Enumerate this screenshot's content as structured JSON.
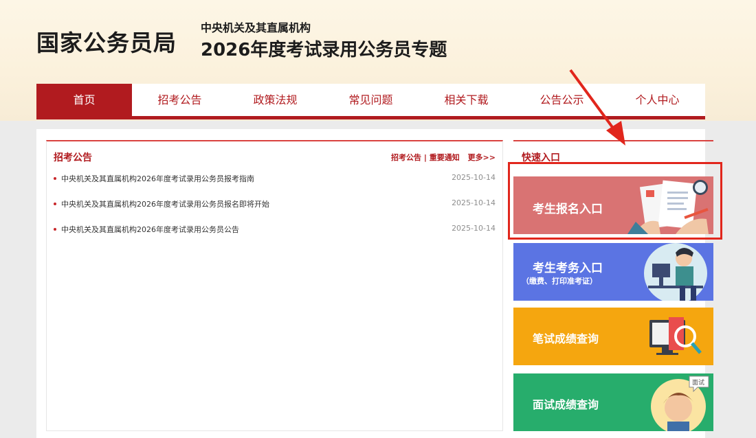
{
  "header": {
    "logo": "国家公务员局",
    "subtitle_line1": "中央机关及其直属机构",
    "subtitle_line2": "2026年度考试录用公务员专题"
  },
  "nav": {
    "items": [
      {
        "label": "首页",
        "active": true
      },
      {
        "label": "招考公告",
        "active": false
      },
      {
        "label": "政策法规",
        "active": false
      },
      {
        "label": "常见问题",
        "active": false
      },
      {
        "label": "相关下载",
        "active": false
      },
      {
        "label": "公告公示",
        "active": false
      },
      {
        "label": "个人中心",
        "active": false
      }
    ]
  },
  "notices": {
    "title": "招考公告",
    "link_announce": "招考公告",
    "separator": "|",
    "link_important": "重要通知",
    "link_more": "更多>>",
    "items": [
      {
        "title": "中央机关及其直属机构2026年度考试录用公务员报考指南",
        "date": "2025-10-14"
      },
      {
        "title": "中央机关及其直属机构2026年度考试录用公务员报名即将开始",
        "date": "2025-10-14"
      },
      {
        "title": "中央机关及其直属机构2026年度考试录用公务员公告",
        "date": "2025-10-14"
      }
    ]
  },
  "quick": {
    "title": "快速入口",
    "registration": "考生报名入口",
    "affairs": "考生考务入口",
    "affairs_sub": "（缴费、打印准考证）",
    "written": "笔试成绩查询",
    "interview": "面试成绩查询",
    "interview_badge": "面试"
  },
  "colors": {
    "brand_red": "#b11b1f",
    "registration_card": "#d97373",
    "affairs_card": "#5b74e3",
    "written_card": "#f5a60f",
    "interview_card": "#27ad6c",
    "annotation_red": "#e1261c"
  }
}
